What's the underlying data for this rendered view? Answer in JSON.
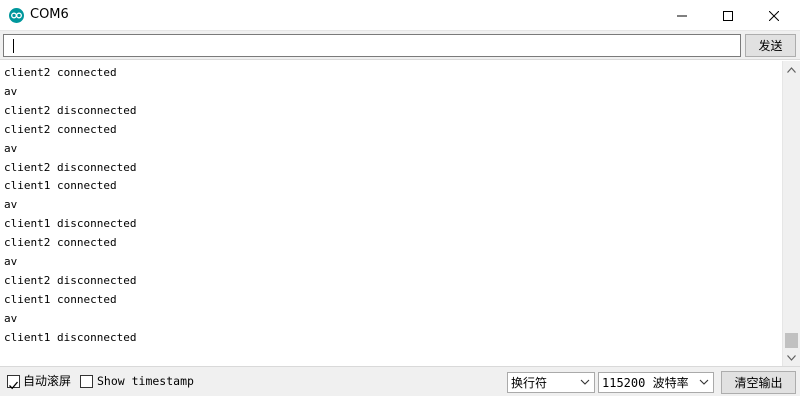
{
  "window": {
    "title": "COM6",
    "icon": "arduino-infinity-icon",
    "accent_color": "#00979c"
  },
  "send_bar": {
    "input_value": "",
    "send_label": "发送"
  },
  "output": {
    "lines": [
      "client2 connected",
      "av",
      "client2 disconnected",
      "client2 connected",
      "av",
      "client2 disconnected",
      "client1 connected",
      "av",
      "client1 disconnected",
      "client2 connected",
      "av",
      "client2 disconnected",
      "client1 connected",
      "av",
      "client1 disconnected"
    ]
  },
  "status_bar": {
    "autoscroll_label": "自动滚屏",
    "autoscroll_checked": true,
    "timestamp_label": "Show timestamp",
    "timestamp_checked": false,
    "line_ending": "换行符",
    "baud_rate": "115200 波特率",
    "clear_label": "清空输出"
  }
}
